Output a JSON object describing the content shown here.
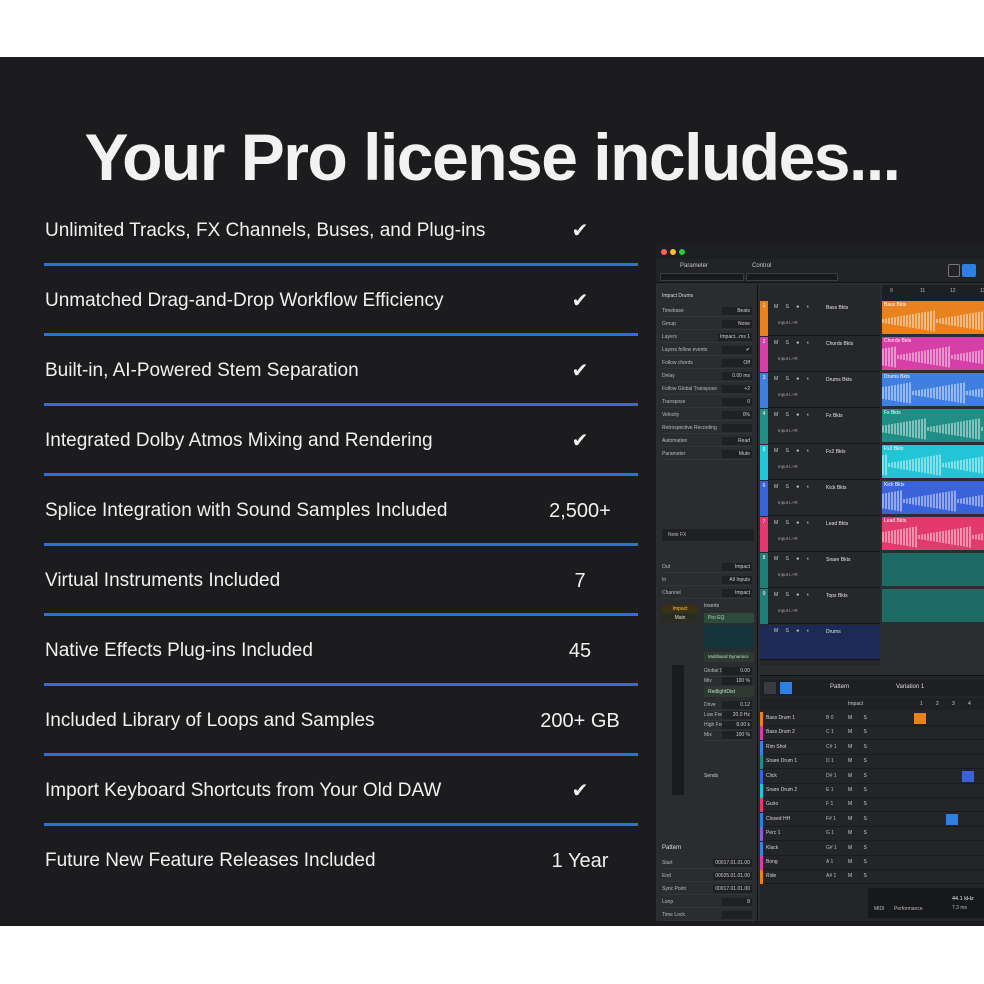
{
  "headline": "Your Pro license includes...",
  "features": [
    {
      "label": "Unlimited Tracks, FX Channels, Buses, and Plug-ins",
      "value": "✔"
    },
    {
      "label": "Unmatched Drag-and-Drop Workflow Efficiency",
      "value": "✔"
    },
    {
      "label": "Built-in, AI-Powered Stem Separation",
      "value": "✔"
    },
    {
      "label": "Integrated Dolby Atmos Mixing and Rendering",
      "value": "✔"
    },
    {
      "label": "Splice Integration with Sound Samples Included",
      "value": "2,500+"
    },
    {
      "label": "Virtual Instruments Included",
      "value": "7"
    },
    {
      "label": "Native Effects Plug-ins Included",
      "value": "45"
    },
    {
      "label": "Included Library of Loops and Samples",
      "value": "200+ GB"
    },
    {
      "label": "Import Keyboard Shortcuts from Your Old DAW",
      "value": "✔"
    },
    {
      "label": "Future New Feature Releases Included",
      "value": "1 Year"
    }
  ],
  "colors": {
    "accent_rule": "#2f6fd6",
    "panel_bg": "#1c1c1e",
    "text": "#f0f0f0"
  },
  "daw": {
    "top_labels": {
      "parameter": "Parameter",
      "control": "Control"
    },
    "inspector": {
      "device": "Impact Drums",
      "rows": [
        {
          "label": "Timebase",
          "value": "Beats"
        },
        {
          "label": "Group",
          "value": "None"
        },
        {
          "label": "Layers",
          "value": "Impact...ms 1"
        },
        {
          "label": "Layers follow events",
          "value": "✔"
        },
        {
          "label": "Follow chords",
          "value": "Off"
        },
        {
          "label": "Delay",
          "value": "0.00 ms"
        },
        {
          "label": "Follow Global Transpose",
          "value": "+2"
        },
        {
          "label": "Transpose",
          "value": "0"
        },
        {
          "label": "Velocity",
          "value": "0%"
        },
        {
          "label": "Retrospective Recording",
          "value": ""
        },
        {
          "label": "Automation",
          "value": "Read"
        },
        {
          "label": "Parameter",
          "value": "Mute"
        }
      ],
      "note_fx": "Note FX",
      "routing": [
        {
          "label": "Out",
          "value": "Impact"
        },
        {
          "label": "In",
          "value": "All Inputs"
        },
        {
          "label": "Channel",
          "value": "Impact"
        }
      ],
      "inserts_label": "Inserts",
      "insert_plugin": "Pro EQ",
      "multiband": "Multiband Dynamics",
      "params": [
        {
          "label": "Global Gain",
          "value": "0.00"
        },
        {
          "label": "Mix",
          "value": "100 %"
        }
      ],
      "redlight": "RedlightDist",
      "params2": [
        {
          "label": "Drive",
          "value": "0.12"
        },
        {
          "label": "Low Freq",
          "value": "20.0 Hz"
        },
        {
          "label": "High Freq",
          "value": "8.00 k"
        },
        {
          "label": "Mix",
          "value": "100 %"
        }
      ],
      "sends": "Sends",
      "channel_name": "Impact",
      "channel_main": "Main",
      "pattern_title": "Pattern",
      "pattern_rows": [
        {
          "label": "Start",
          "value": "00017.01.01.00"
        },
        {
          "label": "End",
          "value": "00025.01.01.00"
        },
        {
          "label": "Sync Point",
          "value": "00017.01.01.00"
        },
        {
          "label": "Loop",
          "value": "8"
        },
        {
          "label": "Time Lock",
          "value": ""
        },
        {
          "label": "Edit Lock",
          "value": ""
        }
      ]
    },
    "tracks": [
      {
        "num": "1",
        "name": "Bass Bkts",
        "clip": "Bass Bkts",
        "color": "#e8821e"
      },
      {
        "num": "2",
        "name": "Chords Bkts",
        "clip": "Chords Bkts",
        "color": "#d63fa8"
      },
      {
        "num": "3",
        "name": "Drums Bkts",
        "clip": "Drums Bkts",
        "color": "#3f7fe0"
      },
      {
        "num": "4",
        "name": "Fx Bkts",
        "clip": "Fx Bkts",
        "color": "#1f8f86"
      },
      {
        "num": "5",
        "name": "Fx2 Bkts",
        "clip": "Fx2 Bkts",
        "color": "#22c5d6"
      },
      {
        "num": "6",
        "name": "Kick Bkts",
        "clip": "Kick Bkts",
        "color": "#3a62d9"
      },
      {
        "num": "7",
        "name": "Lead Bkts",
        "clip": "Lead Bkts",
        "color": "#e23a6d"
      },
      {
        "num": "8",
        "name": "Snare Bkts",
        "clip": "",
        "color": "#1f7f78"
      },
      {
        "num": "9",
        "name": "Tops Bkts",
        "clip": "",
        "color": "#1f7f78"
      }
    ],
    "drums_folder": "Drums",
    "track_input": "Input L+R",
    "ruler": [
      "9",
      "11",
      "12",
      "13"
    ],
    "pattern_toolbar": {
      "pattern": "Pattern",
      "variation": "Variation 1",
      "instrument": "Impact"
    },
    "pattern_cols": [
      "1",
      "2",
      "3",
      "4"
    ],
    "pads": [
      {
        "name": "Bass Drum 1",
        "key": "B 0"
      },
      {
        "name": "Bass Drum 2",
        "key": "C 1"
      },
      {
        "name": "Rim Shot",
        "key": "C# 1"
      },
      {
        "name": "Snare Drum 1",
        "key": "D 1"
      },
      {
        "name": "Click",
        "key": "D# 1"
      },
      {
        "name": "Snare Drum 2",
        "key": "E 1"
      },
      {
        "name": "Guiro",
        "key": "F 1"
      },
      {
        "name": "Closed HH",
        "key": "F# 1"
      },
      {
        "name": "Perc 1",
        "key": "G 1"
      },
      {
        "name": "Klack",
        "key": "G# 1"
      },
      {
        "name": "Bong",
        "key": "A 1"
      },
      {
        "name": "Ride",
        "key": "A# 1"
      }
    ],
    "status": {
      "midi": "MIDI",
      "performance": "Performance",
      "rate": "44.1 kHz",
      "latency": "7.3 ms"
    }
  }
}
